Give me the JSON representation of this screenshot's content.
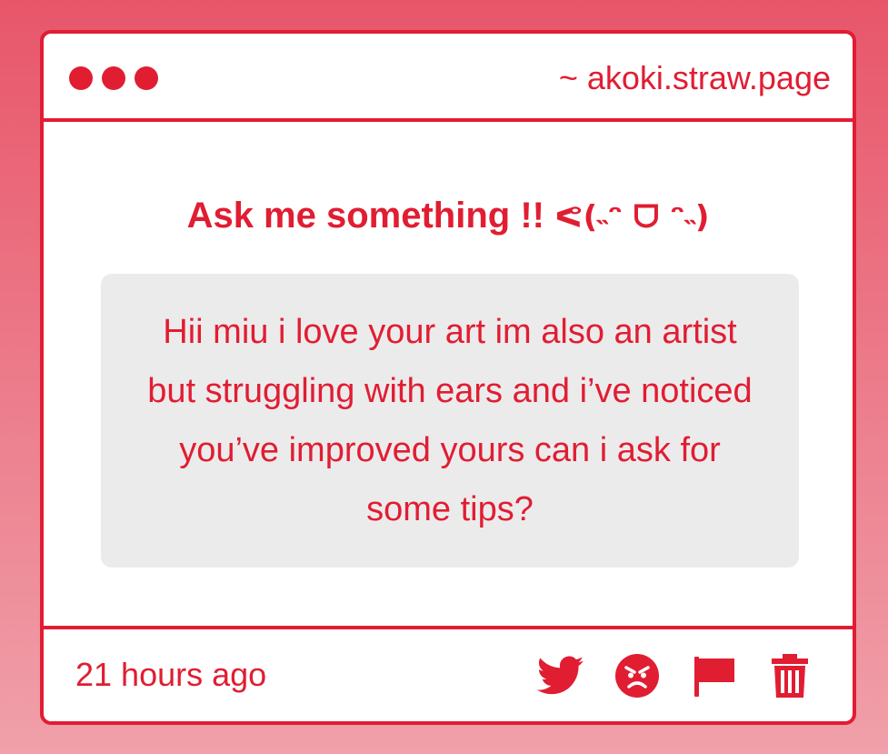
{
  "window": {
    "url": "~ akoki.straw.page"
  },
  "main": {
    "heading": "Ask me something !! ",
    "heading_kaomoji": "ᕙ(˵ᵔ ᗜ ᵔ˵)",
    "message": "Hii miu i love your art im also an artist but struggling with ears and i’ve noticed you’ve improved yours can i ask for some tips?"
  },
  "footer": {
    "timestamp": "21 hours ago",
    "actions": [
      {
        "icon": "twitter-icon"
      },
      {
        "icon": "angry-face-icon"
      },
      {
        "icon": "flag-icon"
      },
      {
        "icon": "trash-icon"
      }
    ]
  },
  "colors": {
    "accent": "#e11d32",
    "background_top": "#e8566a",
    "background_bottom": "#f0a0aa",
    "message_bg": "#ecebec"
  }
}
